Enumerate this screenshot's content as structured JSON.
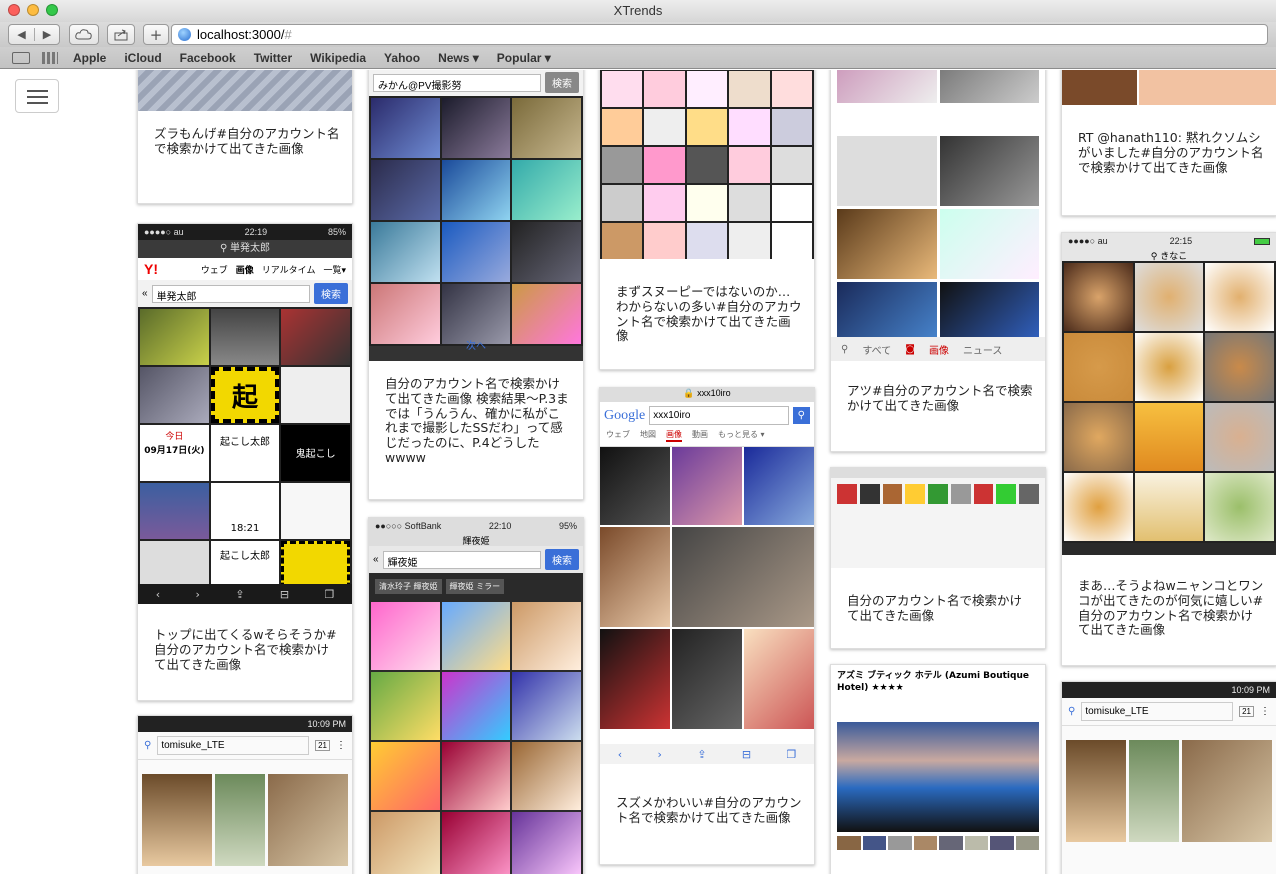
{
  "window": {
    "title": "XTrends"
  },
  "toolbar": {
    "url_host": "localhost:3000/",
    "url_hash": "#"
  },
  "bookmarks": [
    "Apple",
    "iCloud",
    "Facebook",
    "Twitter",
    "Wikipedia",
    "Yahoo",
    "News ▾",
    "Popular ▾"
  ],
  "cards": [
    {
      "caption": "ズラもんげ#自分のアカウント名で検索かけて出てきた画像"
    },
    {
      "caption": "トップに出てくるwそらそうか#自分のアカウント名で検索かけて出てきた画像",
      "screen": {
        "carrier": "●●●●○ au",
        "time": "22:19",
        "battery": "85%",
        "query": "単発太郎",
        "logo": "Y!",
        "tabs": [
          "ウェブ",
          "画像",
          "リアルタイム",
          "一覧▾"
        ],
        "search_button": "検索",
        "tile_texts": [
          "起",
          "今日",
          "09月17日(火)",
          "起こし太郎",
          "鬼起こし",
          "18:21",
          "起こし太郎"
        ]
      }
    },
    {
      "caption": "",
      "screen": {
        "time": "10:09 PM",
        "query": "tomisuke_LTE",
        "tab_count": "21"
      }
    },
    {
      "caption": "自分のアカウント名で検索かけて出てきた画像 検索結果〜P.3までは「うんうん、確かに私がこれまで撮影したSSだわ」って感じだったのに、P.4どうしたwwww",
      "screen": {
        "query": "みかん@PV撮影努",
        "search_button": "検索",
        "next": "次へ"
      }
    },
    {
      "caption": "",
      "screen": {
        "carrier": "●●○○○ SoftBank",
        "time": "22:10",
        "battery": "95%",
        "title": "輝夜姫",
        "query": "輝夜姫",
        "search_button": "検索",
        "chips": [
          "清水玲子 輝夜姫",
          "輝夜姫 ミラー"
        ]
      }
    },
    {
      "caption": "まずスヌーピーではないのか… わからないの多い#自分のアカウント名で検索かけて出てきた画像"
    },
    {
      "caption": "スズメかわいい#自分のアカウント名で検索かけて出てきた画像",
      "screen": {
        "host": "xxx10iro",
        "logo": "Google",
        "query": "xxx10iro",
        "tabs": [
          "ウェブ",
          "地図",
          "画像",
          "動画",
          "もっと見る ▾"
        ]
      }
    },
    {
      "caption": "アツ#自分のアカウント名で検索かけて出てきた画像",
      "screen": {
        "tabs": [
          "すべて",
          "画像",
          "ニュース"
        ]
      }
    },
    {
      "caption": "自分のアカウント名で検索かけて出てきた画像"
    },
    {
      "caption": "",
      "screen": {
        "hotel_title": "アズミ ブティック ホテル (Azumi Boutique Hotel) ★★★★"
      }
    },
    {
      "caption": "RT @hanath110: 黙れクソムシがいました#自分のアカウント名で検索かけて出てきた画像"
    },
    {
      "caption": "まあ…そうよねwニャンコとワンコが出てきたのが何気に嬉しい#自分のアカウント名で検索かけて出てきた画像",
      "screen": {
        "carrier": "●●●●○ au",
        "time": "22:15",
        "query": "きなこ"
      }
    },
    {
      "caption": "",
      "screen": {
        "time": "10:09 PM",
        "query": "tomisuke_LTE",
        "tab_count": "21"
      }
    }
  ],
  "colors": {
    "accent": "#3a6fd8",
    "card_border": "#dddddd",
    "toolbar": "#d0d0d0"
  }
}
